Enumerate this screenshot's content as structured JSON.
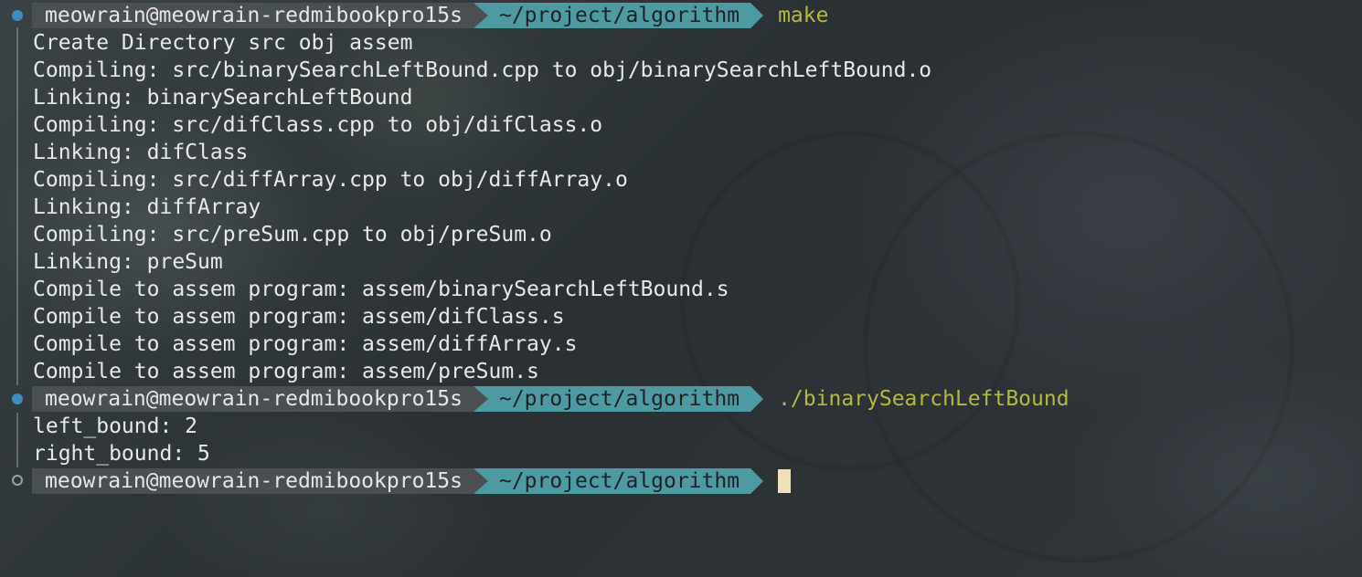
{
  "prompt": {
    "user_host": "meowrain@meowrain-redmibookpro15s",
    "path": "~/project/algorithm"
  },
  "commands": {
    "first": "make",
    "second": "./binarySearchLeftBound"
  },
  "make_output": [
    "Create Directory src obj assem",
    "Compiling: src/binarySearchLeftBound.cpp to obj/binarySearchLeftBound.o",
    "Linking: binarySearchLeftBound",
    "Compiling: src/difClass.cpp to obj/difClass.o",
    "Linking: difClass",
    "Compiling: src/diffArray.cpp to obj/diffArray.o",
    "Linking: diffArray",
    "Compiling: src/preSum.cpp to obj/preSum.o",
    "Linking: preSum",
    "Compile to assem program: assem/binarySearchLeftBound.s",
    "Compile to assem program: assem/difClass.s",
    "Compile to assem program: assem/diffArray.s",
    "Compile to assem program: assem/preSum.s"
  ],
  "program_output": [
    "left_bound: 2",
    "right_bound: 5"
  ],
  "colors": {
    "prompt_user_bg": "#4a4f52",
    "prompt_path_bg": "#4e9aa3",
    "command_text": "#b7b83f",
    "marker_blue": "#3b8fc0",
    "cursor": "#efe0b8"
  }
}
